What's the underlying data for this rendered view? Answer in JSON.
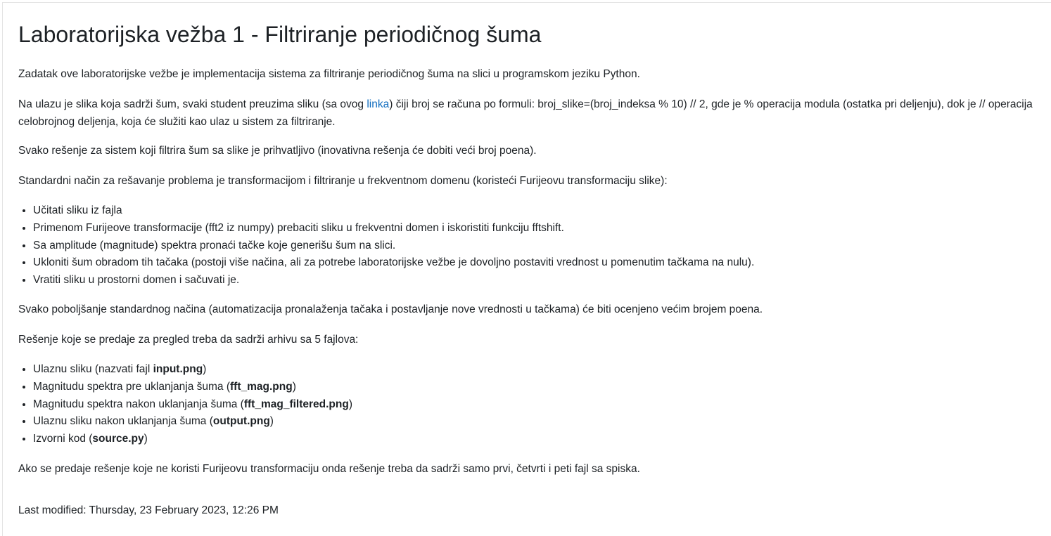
{
  "page": {
    "title": "Laboratorijska vežba 1 - Filtriranje periodičnog šuma"
  },
  "intro": "Zadatak ove laboratorijske vežbe je implementacija sistema za filtriranje periodičnog šuma na slici u programskom jeziku Python.",
  "input_paragraph": {
    "before_link": "Na ulazu je slika koja sadrži šum, svaki student preuzima sliku (sa ovog ",
    "link_text": "linka",
    "after_link": ") čiji broj se računa po formuli: broj_slike=(broj_indeksa % 10) // 2, gde je % operacija modula (ostatka pri deljenju), dok je // operacija celobrojnog deljenja, koja će služiti kao ulaz u sistem za filtriranje."
  },
  "any_solution": "Svako rešenje za sistem koji filtrira šum sa slike je prihvatljivo (inovativna rešenja će dobiti veći broj poena).",
  "standard_method": "Standardni način za rešavanje problema je transformacijom i filtriranje u frekventnom domenu (koristeći Furijeovu transformaciju slike):",
  "steps": [
    "Učitati sliku iz fajla",
    "Primenom Furijeove transformacije (fft2 iz numpy) prebaciti sliku u frekventni domen i iskoristiti funkciju fftshift.",
    "Sa amplitude (magnitude) spektra pronaći tačke koje generišu šum na slici.",
    "Ukloniti šum obradom tih tačaka (postoji više načina, ali za potrebe laboratorijske vežbe je dovoljno postaviti vrednost u pomenutim tačkama na nulu).",
    "Vratiti sliku u prostorni domen i sačuvati je."
  ],
  "improvement": "Svako poboljšanje standardnog načina (automatizacija pronalaženja tačaka i postavljanje nove vrednosti u tačkama) će biti ocenjeno većim brojem poena.",
  "submission_intro": "Rešenje koje se predaje za pregled treba da sadrži arhivu sa 5 fajlova:",
  "files": [
    {
      "before": "Ulaznu sliku (nazvati fajl ",
      "name": "input.png",
      "after": ")"
    },
    {
      "before": "Magnitudu spektra pre uklanjanja šuma (",
      "name": "fft_mag.png",
      "after": ")"
    },
    {
      "before": "Magnitudu spektra nakon uklanjanja šuma (",
      "name": "fft_mag_filtered.png",
      "after": ")"
    },
    {
      "before": "Ulaznu sliku nakon uklanjanja šuma (",
      "name": "output.png",
      "after": ")"
    },
    {
      "before": "Izvorni kod (",
      "name": "source.py",
      "after": ")"
    }
  ],
  "non_fourier_note": "Ako se predaje rešenje koje ne koristi Furijeovu transformaciju onda rešenje treba da sadrži samo prvi, četvrti i peti fajl sa spiska.",
  "last_modified": "Last modified: Thursday, 23 February 2023, 12:26 PM",
  "colors": {
    "text": "#1d2125",
    "link": "#0f6cbf"
  }
}
